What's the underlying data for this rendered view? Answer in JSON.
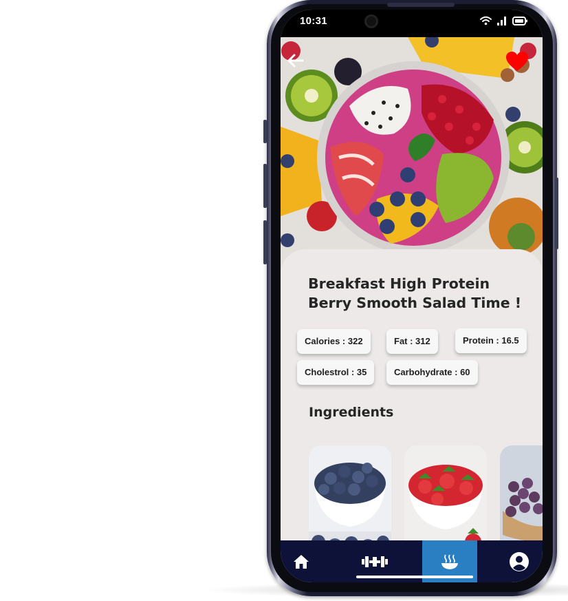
{
  "status_bar": {
    "time": "10:31",
    "icons": [
      "wifi-icon",
      "signal-icon",
      "battery-icon"
    ]
  },
  "header": {
    "back_icon": "arrow-left-icon",
    "favorite_icon": "heart-icon",
    "favorite_color": "#ff0000"
  },
  "recipe": {
    "title_line1": "Breakfast High Protein",
    "title_line2": "Berry Smooth Salad Time !"
  },
  "nutrition": {
    "calories": "Calories : 322",
    "fat": "Fat :  312",
    "protein": "Protein : 16.5",
    "cholestrol": "Cholestrol : 35",
    "carbohydrate": "Carbohydrate : 60"
  },
  "ingredients": {
    "heading": "Ingredients",
    "items": [
      "blueberries-image",
      "strawberries-image",
      "grapes-image"
    ]
  },
  "nav": {
    "items": [
      "home-icon",
      "dumbbell-icon",
      "bowl-icon",
      "account-icon"
    ],
    "active": "bowl-icon"
  },
  "colors": {
    "nav_background": "#0e1238",
    "nav_active": "#2a7fc3",
    "sheet_background": "#ece9e8"
  }
}
